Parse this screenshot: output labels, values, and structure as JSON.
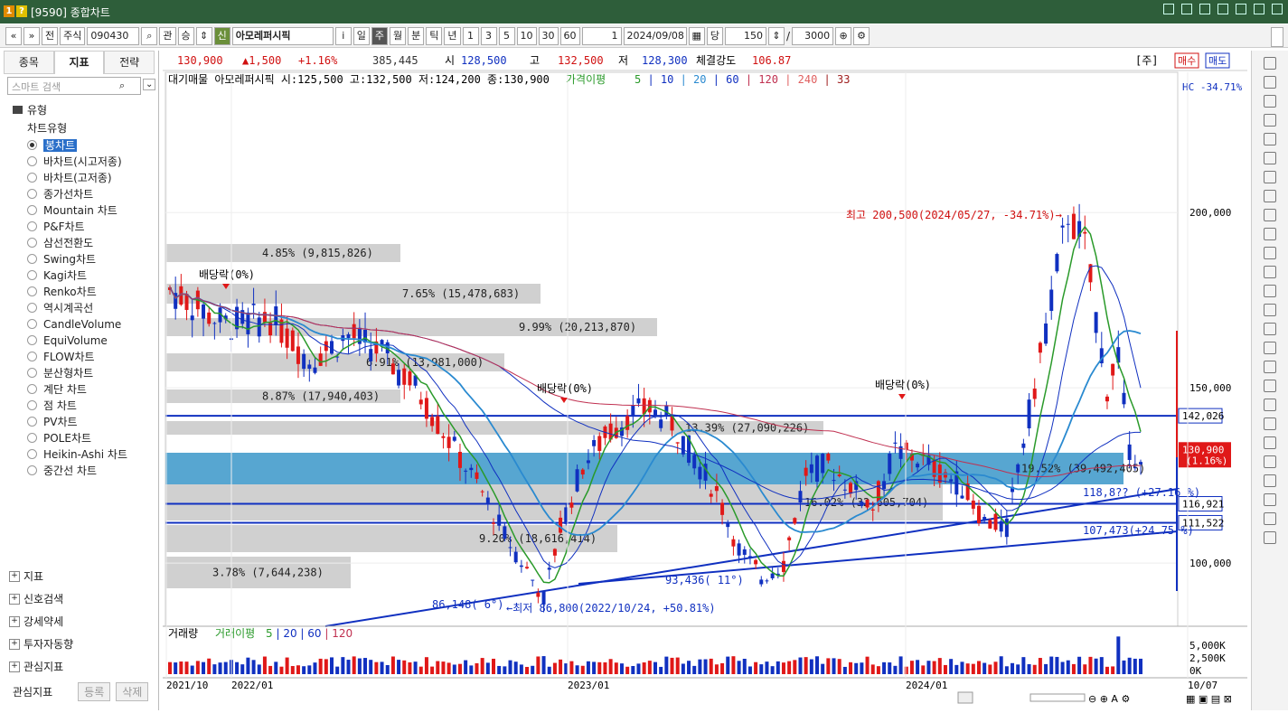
{
  "window": {
    "title": "[9590] 종합차트",
    "badges": [
      "1",
      "?"
    ]
  },
  "toolbar": {
    "nav": [
      "«",
      "»"
    ],
    "market": "전",
    "type": "주식",
    "code": "090430",
    "search_btn": "⌕",
    "rel": "관",
    "up": "승",
    "shin": "신",
    "stock_name": "아모레퍼시픽",
    "info": "i",
    "periods": [
      "일",
      "주",
      "월",
      "분",
      "틱",
      "년"
    ],
    "period_active": "주",
    "intervals": [
      "1",
      "3",
      "5",
      "10",
      "30",
      "60"
    ],
    "count_val": "1",
    "date": "2024/09/08",
    "dang": "당",
    "qty": "150",
    "slash": "/",
    "max": "3000"
  },
  "quote": {
    "price": "130,900",
    "change": "▲1,500",
    "pct": "+1.16%",
    "volume": "385,445",
    "open_lbl": "시",
    "open": "128,500",
    "high_lbl": "고",
    "high": "132,500",
    "low_lbl": "저",
    "low": "128,300",
    "strength_lbl": "체결강도",
    "strength": "106.87",
    "week_lbl": "[주]",
    "buy": "매수",
    "sell": "매도"
  },
  "legend": {
    "stock_info": "대기매물 아모레퍼시픽 시:125,500 고:132,500 저:124,200 종:130,900",
    "ma_label": "가격이평",
    "ma": [
      "5",
      "10",
      "20",
      "60",
      "120",
      "240",
      "33"
    ],
    "vol_legend": "거래량",
    "vol_ma": "거래이평",
    "vol_ma_vals": [
      "5",
      "20",
      "60",
      "120"
    ],
    "hc": "HC -34.71%"
  },
  "left": {
    "tabs": [
      "종목",
      "지표",
      "전략"
    ],
    "active_tab": "지표",
    "search_placeholder": "스마트 검색",
    "section": "유형",
    "subsection": "차트유형",
    "chart_types": [
      "봉차트",
      "바차트(시고저종)",
      "바차트(고저종)",
      "종가선차트",
      "Mountain 차트",
      "P&F차트",
      "삼선전환도",
      "Swing차트",
      "Kagi차트",
      "Renko차트",
      "역시계곡선",
      "CandleVolume",
      "EquiVolume",
      "FLOW차트",
      "분산형차트",
      "계단 차트",
      "점 차트",
      "PV차트",
      "POLE차트",
      "Heikin-Ashi 차트",
      "중간선 차트"
    ],
    "selected": "봉차트",
    "groups": [
      "지표",
      "신호검색",
      "강세약세",
      "투자자동향",
      "관심지표"
    ],
    "footer": {
      "label": "관심지표",
      "reg": "등록",
      "del": "삭제"
    }
  },
  "chart_data": {
    "type": "candlestick",
    "y_ticks": [
      "200,000",
      "150,000",
      "100,000"
    ],
    "y_range": [
      82000,
      240000
    ],
    "x_labels": [
      "2021/10",
      "2022/01",
      "2023/01",
      "2024/01",
      "10/07"
    ],
    "price_labels": {
      "current": "130,900",
      "current_pct": "(1.16%)",
      "l1": "142,026",
      "l2": "116,921",
      "l3": "111,522"
    },
    "max_annotation": "최고 200,500(2024/05/27, -34.71%)→",
    "min_annotation": "←최저 86,800(2022/10/24, +50.81%)",
    "dividend": "배당락(0%)",
    "volume_profile": [
      {
        "label": "4.85% (9,815,826)"
      },
      {
        "label": "7.65% (15,478,683)"
      },
      {
        "label": "9.99% (20,213,870)"
      },
      {
        "label": "6.91% (13,981,000)"
      },
      {
        "label": "8.87% (17,940,403)"
      },
      {
        "label": "13.39% (27,090,226)"
      },
      {
        "label": "19.52% (39,492,405)"
      },
      {
        "label": "16.02% (32,605,704)"
      },
      {
        "label": "9.20% (18,616,414)"
      },
      {
        "label": "3.78% (7,644,238)"
      }
    ],
    "trendline_labels": [
      "118,8?? (+27.16 %)",
      "107,473(+24.75 %)",
      "93,436( 11°)",
      "86,148( 6°)"
    ],
    "vol_ticks": [
      "5,000K",
      "2,500K",
      "0K"
    ],
    "candles": []
  }
}
